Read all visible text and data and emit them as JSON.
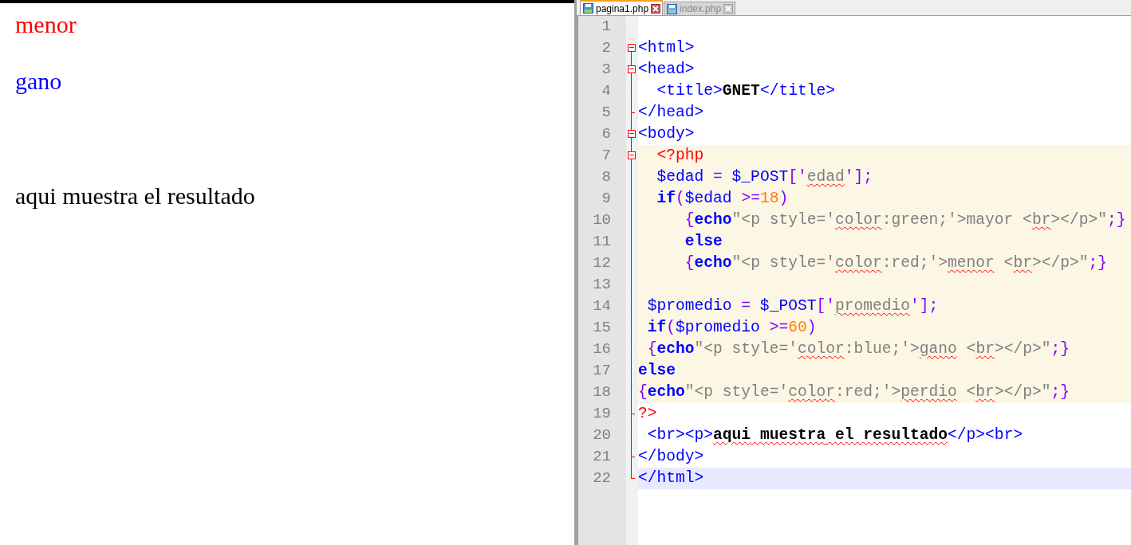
{
  "browser_output": [
    {
      "text": "menor",
      "color": "#ff0000"
    },
    {
      "text": "gano",
      "color": "#0000ff"
    },
    {
      "text": "aqui muestra el resultado",
      "color": "#000000"
    }
  ],
  "tabs": [
    {
      "label": "pagina1.php",
      "selected": true
    },
    {
      "label": "index.php",
      "selected": false
    }
  ],
  "lines": [
    {
      "num": "1",
      "kind": "plain",
      "php": false,
      "current": false
    },
    {
      "num": "2",
      "kind": "fold_start",
      "php": false,
      "current": false,
      "tokens": [
        {
          "kind": "tag",
          "text": "<html>"
        }
      ]
    },
    {
      "num": "3",
      "kind": "fold_start",
      "php": false,
      "current": false,
      "tokens": [
        {
          "kind": "tag",
          "text": "<head>"
        }
      ]
    },
    {
      "num": "4",
      "kind": "inner",
      "php": false,
      "current": false,
      "tokens": [
        {
          "kind": "tag",
          "text": "  <title>"
        },
        {
          "kind": "txt",
          "text": "GNET"
        },
        {
          "kind": "tag",
          "text": "</title>"
        }
      ]
    },
    {
      "num": "5",
      "kind": "fold_end",
      "php": false,
      "current": false,
      "tokens": [
        {
          "kind": "tag",
          "text": "</head>"
        }
      ]
    },
    {
      "num": "6",
      "kind": "fold_start",
      "php": false,
      "current": false,
      "tokens": [
        {
          "kind": "tag",
          "text": "<body>"
        }
      ]
    },
    {
      "num": "7",
      "kind": "fold_start",
      "php": true,
      "current": false,
      "tokens": [
        {
          "kind": "php",
          "text": "  <?php"
        }
      ]
    },
    {
      "num": "8",
      "kind": "inner",
      "php": true,
      "current": false,
      "tokens": [
        {
          "kind": "var",
          "text": "  $edad "
        },
        {
          "kind": "op",
          "text": "="
        },
        {
          "kind": "var",
          "text": " $_POST"
        },
        {
          "kind": "op",
          "text": "['"
        },
        {
          "kind": "strx",
          "text": "edad"
        },
        {
          "kind": "op",
          "text": "'];"
        }
      ]
    },
    {
      "num": "9",
      "kind": "inner",
      "php": true,
      "current": false,
      "tokens": [
        {
          "kind": "kw",
          "text": "  if"
        },
        {
          "kind": "op",
          "text": "("
        },
        {
          "kind": "var",
          "text": "$edad "
        },
        {
          "kind": "op",
          "text": ">="
        },
        {
          "kind": "num",
          "text": "18"
        },
        {
          "kind": "op",
          "text": ")"
        }
      ]
    },
    {
      "num": "10",
      "kind": "inner",
      "php": true,
      "current": false,
      "tokens": [
        {
          "kind": "op",
          "text": "     {"
        },
        {
          "kind": "kw",
          "text": "echo"
        },
        {
          "kind": "str",
          "text": "\"<p style='"
        },
        {
          "kind": "strx",
          "text": "color"
        },
        {
          "kind": "str",
          "text": ":green;'>mayor <"
        },
        {
          "kind": "strx",
          "text": "br"
        },
        {
          "kind": "str",
          "text": "></p>\""
        },
        {
          "kind": "op",
          "text": ";}"
        }
      ]
    },
    {
      "num": "11",
      "kind": "inner",
      "php": true,
      "current": false,
      "tokens": [
        {
          "kind": "kw",
          "text": "     else"
        }
      ]
    },
    {
      "num": "12",
      "kind": "inner",
      "php": true,
      "current": false,
      "tokens": [
        {
          "kind": "op",
          "text": "     {"
        },
        {
          "kind": "kw",
          "text": "echo"
        },
        {
          "kind": "str",
          "text": "\"<p style='"
        },
        {
          "kind": "strx",
          "text": "color"
        },
        {
          "kind": "str",
          "text": ":red;'>"
        },
        {
          "kind": "strx",
          "text": "menor"
        },
        {
          "kind": "str",
          "text": " <"
        },
        {
          "kind": "strx",
          "text": "br"
        },
        {
          "kind": "str",
          "text": "></p>\""
        },
        {
          "kind": "op",
          "text": ";}"
        }
      ]
    },
    {
      "num": "13",
      "kind": "inner",
      "php": true,
      "current": false
    },
    {
      "num": "14",
      "kind": "inner",
      "php": true,
      "current": false,
      "tokens": [
        {
          "kind": "var",
          "text": " $promedio "
        },
        {
          "kind": "op",
          "text": "="
        },
        {
          "kind": "var",
          "text": " $_POST"
        },
        {
          "kind": "op",
          "text": "['"
        },
        {
          "kind": "strx",
          "text": "promedio"
        },
        {
          "kind": "op",
          "text": "'];"
        }
      ]
    },
    {
      "num": "15",
      "kind": "inner",
      "php": true,
      "current": false,
      "tokens": [
        {
          "kind": "kw",
          "text": " if"
        },
        {
          "kind": "op",
          "text": "("
        },
        {
          "kind": "var",
          "text": "$promedio "
        },
        {
          "kind": "op",
          "text": ">="
        },
        {
          "kind": "num",
          "text": "60"
        },
        {
          "kind": "op",
          "text": ")"
        }
      ]
    },
    {
      "num": "16",
      "kind": "inner",
      "php": true,
      "current": false,
      "tokens": [
        {
          "kind": "op",
          "text": " {"
        },
        {
          "kind": "kw",
          "text": "echo"
        },
        {
          "kind": "str",
          "text": "\"<p style='"
        },
        {
          "kind": "strx",
          "text": "color"
        },
        {
          "kind": "str",
          "text": ":blue;'>"
        },
        {
          "kind": "strx",
          "text": "gano"
        },
        {
          "kind": "str",
          "text": " <"
        },
        {
          "kind": "strx",
          "text": "br"
        },
        {
          "kind": "str",
          "text": "></p>\""
        },
        {
          "kind": "op",
          "text": ";}"
        }
      ]
    },
    {
      "num": "17",
      "kind": "inner",
      "php": true,
      "current": false,
      "tokens": [
        {
          "kind": "kw",
          "text": "else"
        }
      ]
    },
    {
      "num": "18",
      "kind": "inner",
      "php": true,
      "current": false,
      "tokens": [
        {
          "kind": "op",
          "text": "{"
        },
        {
          "kind": "kw",
          "text": "echo"
        },
        {
          "kind": "str",
          "text": "\"<p style='"
        },
        {
          "kind": "strx",
          "text": "color"
        },
        {
          "kind": "str",
          "text": ":red;'>"
        },
        {
          "kind": "strx",
          "text": "perdio"
        },
        {
          "kind": "str",
          "text": " <"
        },
        {
          "kind": "strx",
          "text": "br"
        },
        {
          "kind": "str",
          "text": "></p>\""
        },
        {
          "kind": "op",
          "text": ";}"
        }
      ]
    },
    {
      "num": "19",
      "kind": "fold_end",
      "php": false,
      "current": false,
      "tokens": [
        {
          "kind": "php",
          "text": "?>"
        }
      ]
    },
    {
      "num": "20",
      "kind": "inner",
      "php": false,
      "current": false,
      "tokens": [
        {
          "kind": "tag",
          "text": " <br><p>"
        },
        {
          "kind": "txtx",
          "text": "aqui"
        },
        {
          "kind": "txtx",
          "text": " muestra"
        },
        {
          "kind": "txtx",
          "text": " el"
        },
        {
          "kind": "txtx",
          "text": " resultado"
        },
        {
          "kind": "tag",
          "text": "</p><br>"
        }
      ]
    },
    {
      "num": "21",
      "kind": "fold_end",
      "php": false,
      "current": false,
      "tokens": [
        {
          "kind": "tag",
          "text": "</body>"
        }
      ]
    },
    {
      "num": "22",
      "kind": "fold_last",
      "php": false,
      "current": true,
      "tokens": [
        {
          "kind": "tag",
          "text": "</html>"
        }
      ]
    }
  ]
}
